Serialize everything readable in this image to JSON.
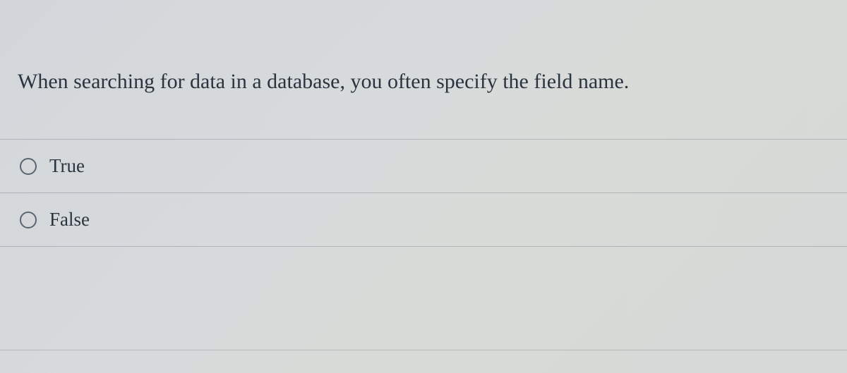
{
  "question": {
    "text": "When searching for data in a database, you often specify the field name."
  },
  "options": [
    {
      "label": "True"
    },
    {
      "label": "False"
    }
  ]
}
